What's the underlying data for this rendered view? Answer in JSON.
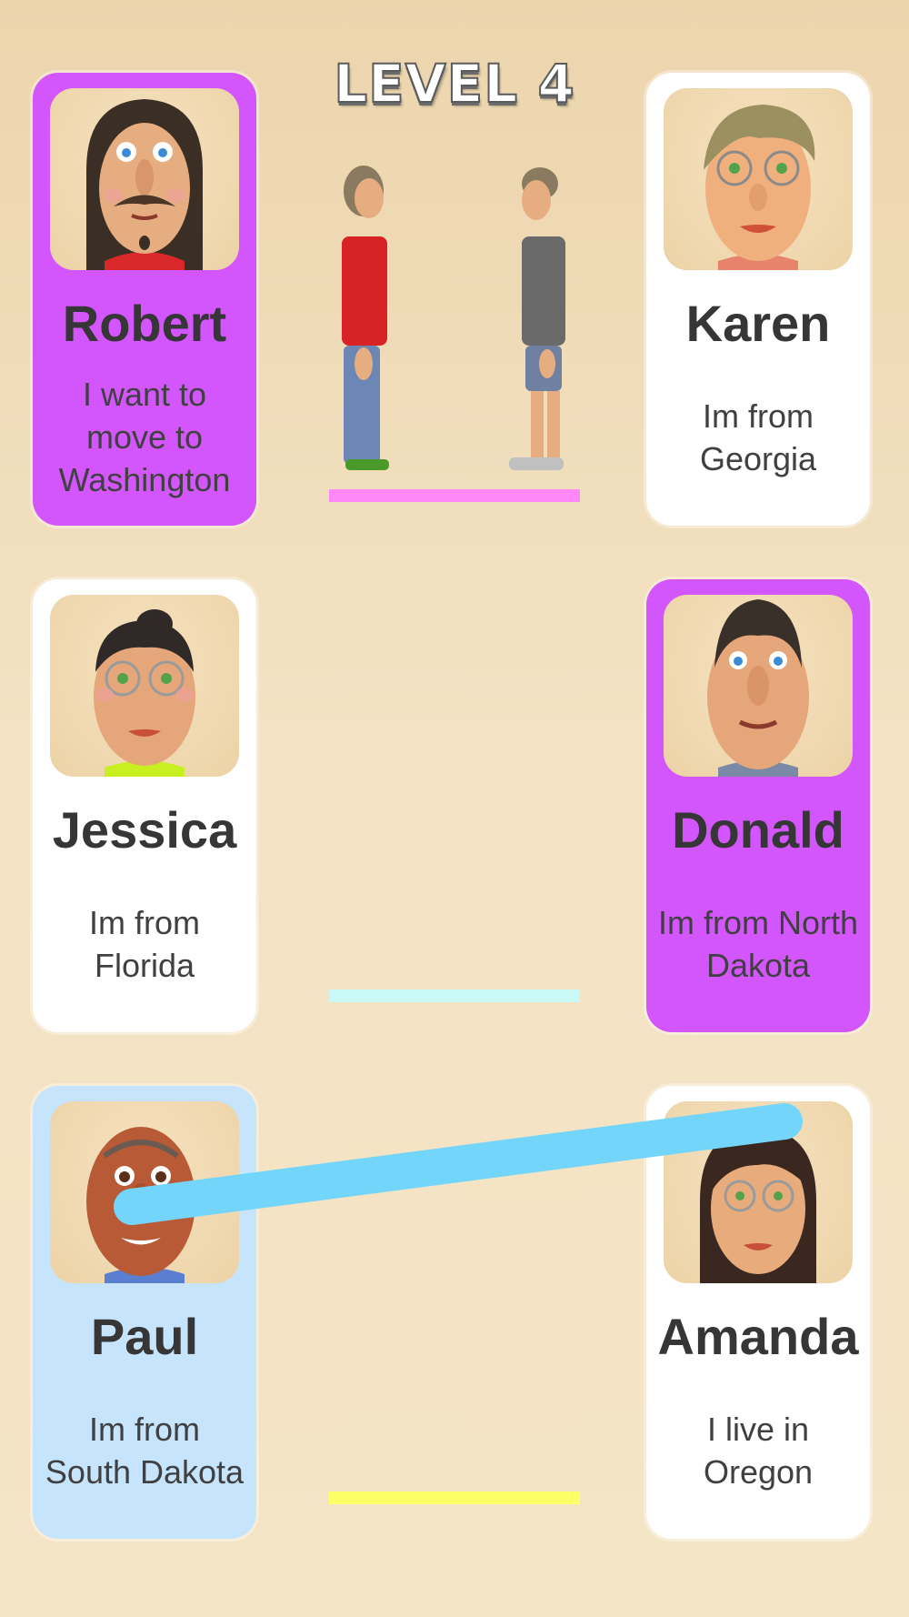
{
  "level": {
    "title": "LEVEL 4"
  },
  "colors": {
    "selected_purple": "#d356fc",
    "selected_blue": "#c7e4fd",
    "card_white": "#ffffff",
    "line_pink": "#ff87f7",
    "line_cyan": "#c8f9f7",
    "line_yellow": "#ffff66",
    "connector_blue": "#74d5fb"
  },
  "cards": {
    "robert": {
      "name": "Robert",
      "desc": "I want to\nmove to\nWashington",
      "state": "selected-purple",
      "portrait_icon": "long-hair-mustache-man-avatar"
    },
    "karen": {
      "name": "Karen",
      "desc": "Im from\nGeorgia",
      "state": "unselected",
      "portrait_icon": "glasses-woman-avatar"
    },
    "jessica": {
      "name": "Jessica",
      "desc": "Im from\nFlorida",
      "state": "unselected",
      "portrait_icon": "glasses-woman-bun-avatar"
    },
    "donald": {
      "name": "Donald",
      "desc": "Im from North\nDakota",
      "state": "selected-purple",
      "portrait_icon": "slick-hair-man-avatar"
    },
    "paul": {
      "name": "Paul",
      "desc": "Im from\nSouth Dakota",
      "state": "selected-blue",
      "portrait_icon": "bald-man-avatar"
    },
    "amanda": {
      "name": "Amanda",
      "desc": "I live in\nOregon",
      "state": "unselected",
      "portrait_icon": "glasses-woman-dark-hair-avatar"
    }
  },
  "match_slots": [
    {
      "color_key": "line_pink",
      "content": "two-characters-facing"
    },
    {
      "color_key": "line_cyan",
      "content": "empty"
    },
    {
      "color_key": "line_yellow",
      "content": "empty"
    }
  ],
  "connector": {
    "from": "paul",
    "to": "amanda",
    "color_key": "connector_blue"
  }
}
